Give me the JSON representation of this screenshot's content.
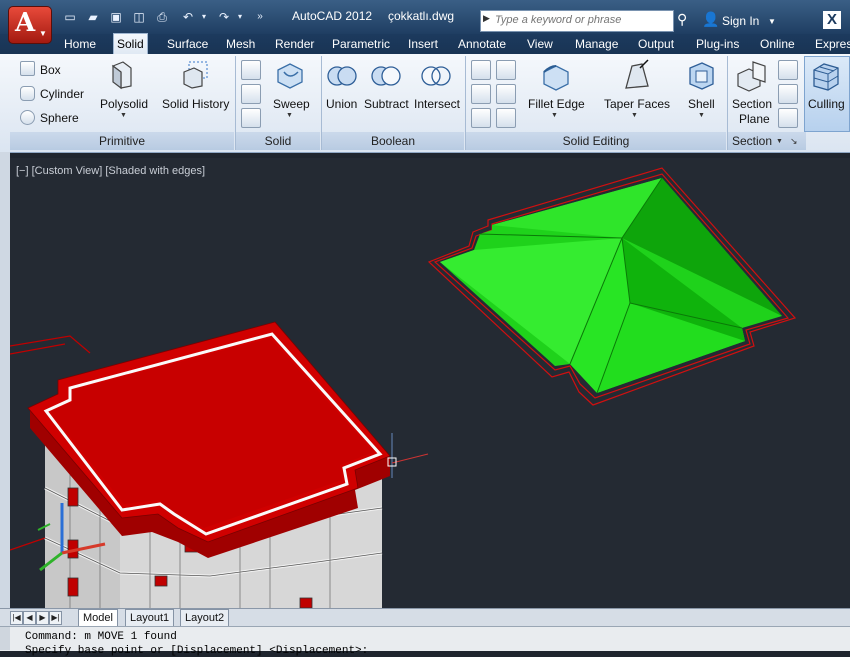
{
  "title_bar": {
    "app_title": "AutoCAD 2012",
    "file_name": "çokkatlı.dwg",
    "search_placeholder": "Type a keyword or phrase",
    "sign_in": "Sign In",
    "app_icon_letter": "A",
    "quick_access": [
      "new-icon",
      "open-icon",
      "save-icon",
      "saveas-icon",
      "print-icon",
      "undo-icon",
      "undo-dropdown-icon",
      "redo-icon",
      "redo-dropdown-icon",
      "more-icon"
    ]
  },
  "tabs": [
    "Home",
    "Solid",
    "Surface",
    "Mesh",
    "Render",
    "Parametric",
    "Insert",
    "Annotate",
    "View",
    "Manage",
    "Output",
    "Plug-ins",
    "Online",
    "Express"
  ],
  "active_tab": "Solid",
  "ribbon": {
    "primitive": {
      "title": "Primitive",
      "box": "Box",
      "cylinder": "Cylinder",
      "sphere": "Sphere",
      "polysolid": "Polysolid",
      "solid_history": "Solid History"
    },
    "solid": {
      "title": "Solid",
      "sweep": "Sweep"
    },
    "boolean": {
      "title": "Boolean",
      "union": "Union",
      "subtract": "Subtract",
      "intersect": "Intersect"
    },
    "solid_editing": {
      "title": "Solid Editing",
      "fillet_edge": "Fillet Edge",
      "taper_faces": "Taper Faces",
      "shell": "Shell"
    },
    "section": {
      "title": "Section",
      "section_plane_1": "Section",
      "section_plane_2": "Plane",
      "culling": "Culling"
    }
  },
  "viewport": {
    "label": "[−] [Custom View] [Shaded with edges]",
    "colors": {
      "background": "#242a33",
      "roof_green": "#22e01e",
      "roof_red": "#c80000",
      "wall": "#d8d8d8"
    }
  },
  "layout_tabs": [
    "Model",
    "Layout1",
    "Layout2"
  ],
  "active_layout": "Model",
  "command_line": {
    "line1": "Command: m MOVE 1 found",
    "line2": "Specify base point or [Displacement] <Displacement>:"
  }
}
